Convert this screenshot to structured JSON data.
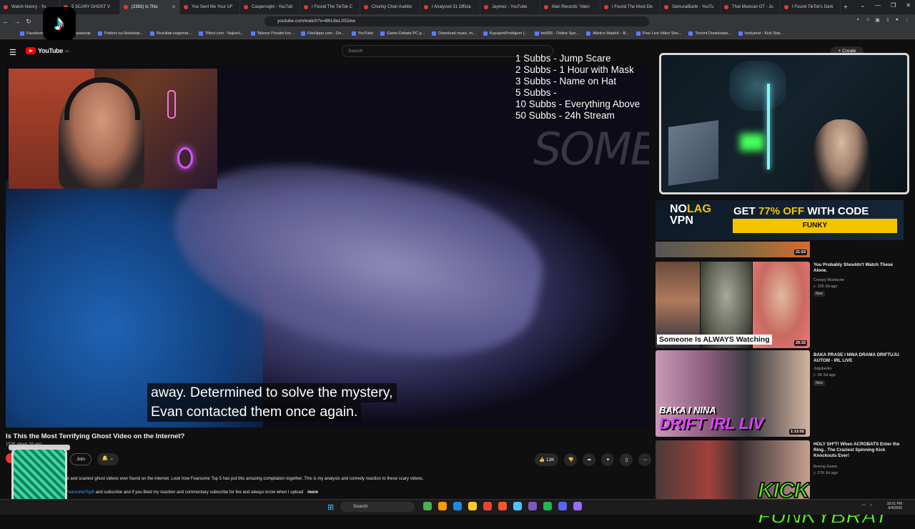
{
  "browser": {
    "tabs": [
      {
        "label": "Watch history - Yo",
        "active": false
      },
      {
        "label": "5 SCARY GHOST V",
        "active": false
      },
      {
        "label": "(2392) Is This",
        "active": true
      },
      {
        "label": "You Sent Me Your UF",
        "active": false
      },
      {
        "label": "Caspersight - YouTub",
        "active": false
      },
      {
        "label": "I Found The TikTok C",
        "active": false
      },
      {
        "label": "Chunky Choir Auditio",
        "active": false
      },
      {
        "label": "I Analyzed 31 Officia",
        "active": false
      },
      {
        "label": "Jaymez - YouTube",
        "active": false
      },
      {
        "label": "Man Records \"Alien",
        "active": false
      },
      {
        "label": "I Found The Most Dis",
        "active": false
      },
      {
        "label": "SamuraiBarbi - YouTu",
        "active": false
      },
      {
        "label": "That Mexican OT - Ju",
        "active": false
      },
      {
        "label": "I Found TikTok's Dark",
        "active": false
      }
    ],
    "new_tab": "+",
    "window_controls": [
      "⌄",
      "—",
      "❐",
      "✕"
    ],
    "url": "youtube.com/watch?v=8KL6eLX52ew",
    "bookmarks": [
      "Facebook",
      "Ependaja spasenje",
      "Pokloni na Nordstop...",
      "Rezultati nogomet...",
      "Titlovi.com - Najveći...",
      "Telenor Privatni kor...",
      "FileHippo.com - Do...",
      "YouTube",
      "Game-Debate PC g...",
      "Download music, m...",
      "KupujemProdajem |...",
      "bet365 - Online Spo...",
      "Atletico Madrid – B...",
      "Free Live Video Stre...",
      "Torrent Downloads...",
      "funkybrat - Kick Stat..."
    ]
  },
  "youtube": {
    "logo_text": "YouTube",
    "logo_sup": "RS",
    "search_placeholder": "Search",
    "create_label": "+ Create"
  },
  "video": {
    "watermark": "SOME",
    "caption_line1": "away. Determined to solve the mystery,",
    "caption_line2": "Evan contacted them once again.",
    "title": "Is This the Most Terrifying Ghost Video on the Internet?",
    "views": "152K views  2d ago",
    "join_label": "Join",
    "bell_label": "🔔 ⌄",
    "likes": "13K",
    "description_line1": "st and scariest ghost videos ever found on the internet. Look how Fearsome Top 5 has put this amazing compilation together. This is my analysis and comedy reaction to these scary videos.",
    "description_link": "FearsomeTop5",
    "description_line2": " and subscribe and if you liked my reaction and commentary subscribe for fee and always know when I upload",
    "more_label": "more"
  },
  "overlay": {
    "subs_goals": [
      "1 Subbs - Jump Scare",
      "2 Subbs - 1 Hour with Mask",
      "3 Subbs - Name on Hat",
      "5 Subbs -",
      "10 Subbs - Everything Above",
      "50 Subbs - 24h Stream"
    ],
    "kick_logo": "KICK FUNKYBRAT",
    "tiktok_glyph": "♪"
  },
  "sidebar": {
    "ad": {
      "logo_top": "NO",
      "logo_accent": "LAG",
      "logo_bottom": "VPN",
      "headline_pre": "GET ",
      "headline_accent": "77% OFF",
      "headline_post": " WITH CODE",
      "code": "FUNKY"
    },
    "prev_duration": "21:53",
    "videos": [
      {
        "title": "You Probably Shouldn't Watch These Alone.",
        "channel": "Creepy Mustache",
        "meta": "▷ 325  2d ago",
        "badge": "New",
        "duration": "29:33",
        "banner": "Someone Is ALWAYS Watching"
      },
      {
        "title": "BAKA PRASE I NINA DRAMA DRIFTUJU AUTOM - IRL LIVE",
        "channel": "Jutjuberko",
        "meta": "▷ 6K  5d ago",
        "badge": "New",
        "duration": "1:12:02",
        "overlay_top": "BAKA I NINA",
        "overlay_bottom": "DRIFT IRL LIV"
      },
      {
        "title": "HOLY SH*T! When ACROBATS Enter the Ring.. The Craziest Spinning Kick Knockouts Ever!",
        "channel": "Boxing Game",
        "meta": "▷ 27K  6d ago",
        "badge": ""
      }
    ]
  },
  "taskbar": {
    "search_label": "Search",
    "time": "10:01 PM",
    "date": "6/4/2026",
    "icon_colors": [
      "#4caf50",
      "#ff9800",
      "#1e88e5",
      "#ffca28",
      "#ea4335",
      "#fb542b",
      "#4cc2ff",
      "#7e57c2",
      "#1db954",
      "#5865f2",
      "#9b6bff"
    ]
  }
}
